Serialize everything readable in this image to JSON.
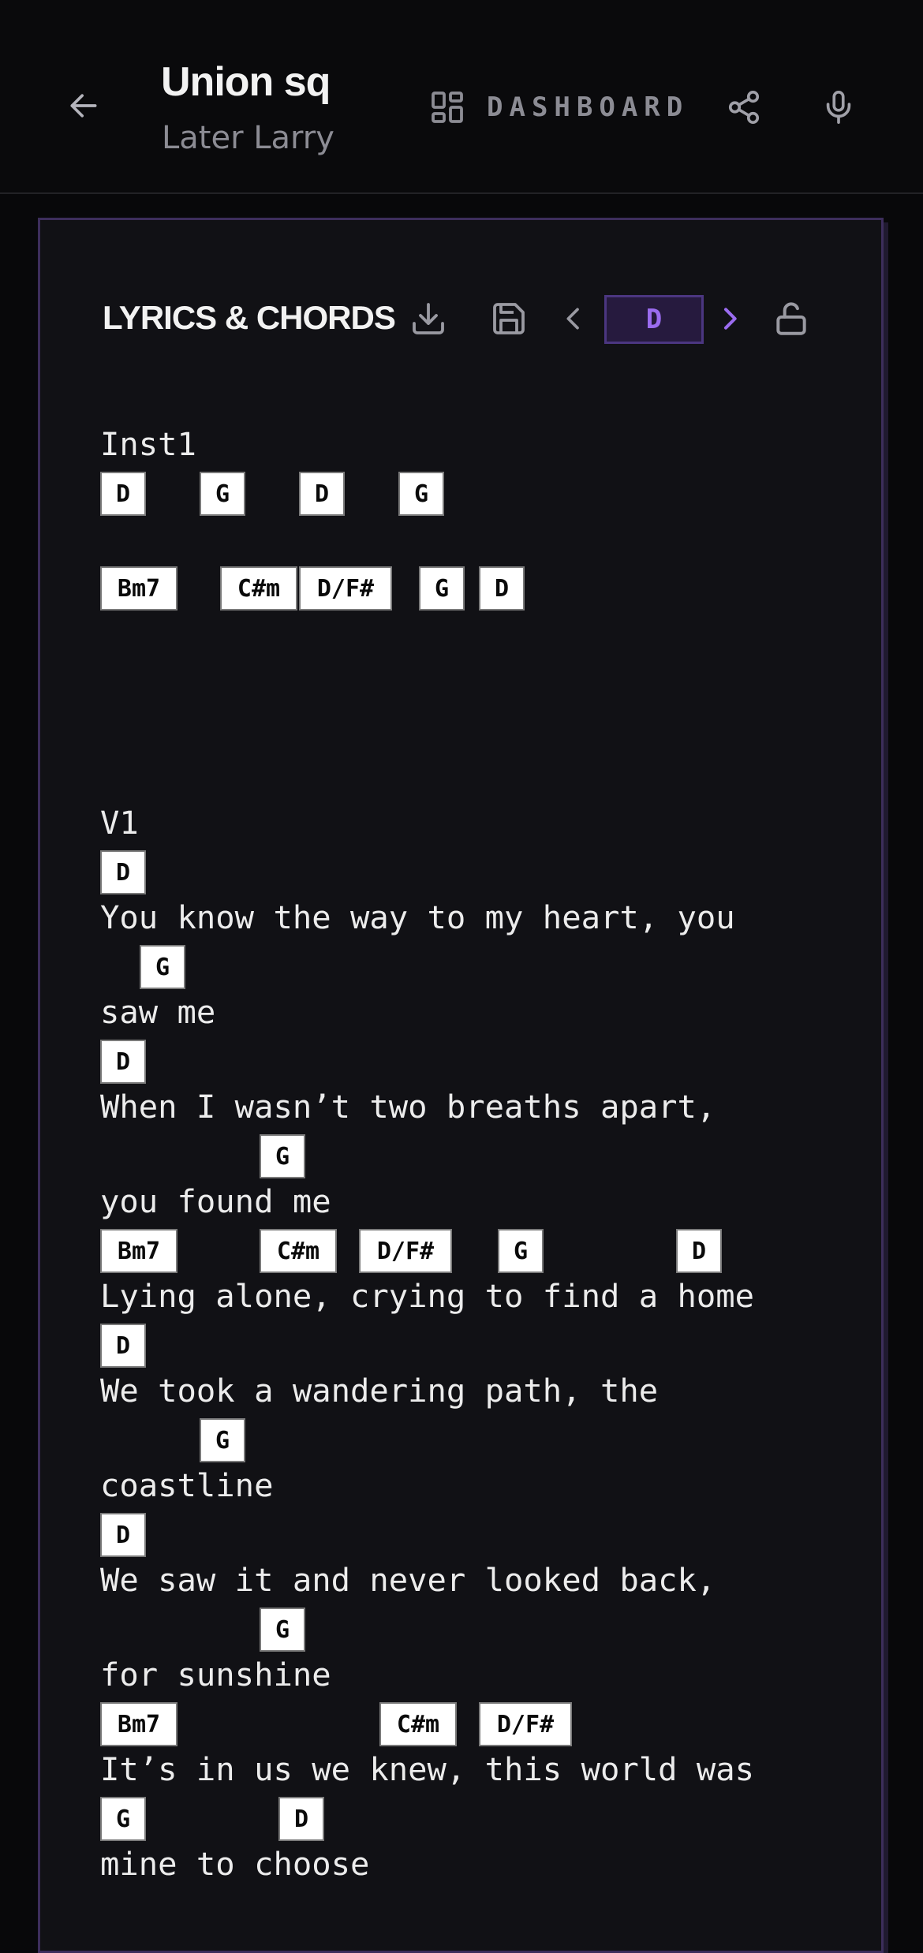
{
  "header": {
    "title": "Union sq",
    "subtitle": "Later Larry",
    "dashboard_label": "DASHBOARD"
  },
  "card": {
    "title": "LYRICS & CHORDS",
    "key": "D"
  },
  "sections": [
    {
      "label": "Inst1",
      "lines": [
        {
          "chords": [
            "D",
            "G",
            "D",
            "G"
          ],
          "lyric": ""
        },
        {
          "chords": [
            "Bm7",
            "C#m",
            "D/F#",
            "G",
            "D"
          ],
          "lyric": ""
        }
      ]
    },
    {
      "label": "V1",
      "lines": [
        {
          "chords": [
            "D"
          ],
          "lyric": "You know the way to my heart, you"
        },
        {
          "chords": [
            "G"
          ],
          "lyric": "saw me"
        },
        {
          "chords": [
            "D"
          ],
          "lyric": "When I wasn’t two breaths apart,"
        },
        {
          "chords": [
            "G"
          ],
          "lyric": "you found me"
        },
        {
          "chords": [
            "Bm7",
            "C#m",
            "D/F#",
            "G",
            "D"
          ],
          "lyric": "Lying alone, crying to find a home"
        },
        {
          "chords": [
            "D"
          ],
          "lyric": "We took a wandering path, the"
        },
        {
          "chords": [
            "G"
          ],
          "lyric": "coastline"
        },
        {
          "chords": [
            "D"
          ],
          "lyric": "We saw it and never looked back,"
        },
        {
          "chords": [
            "G"
          ],
          "lyric": "for sunshine"
        },
        {
          "chords": [
            "Bm7",
            "C#m",
            "D/F#"
          ],
          "lyric": "It’s in us we knew, this world was"
        },
        {
          "chords": [
            "G",
            "D"
          ],
          "lyric": "mine to choose"
        }
      ]
    }
  ],
  "colors": {
    "accent": "#9b6cf0",
    "background": "#08080a",
    "card_border": "#3d2e5c",
    "chord_bg": "#ffffff"
  },
  "icons": {
    "back": "arrow-left-icon",
    "dashboard": "dashboard-grid-icon",
    "share": "share-icon",
    "mic": "microphone-icon",
    "download": "download-icon",
    "save": "save-icon",
    "prev_key": "chevron-left-icon",
    "next_key": "chevron-right-icon",
    "lock": "unlock-icon"
  }
}
